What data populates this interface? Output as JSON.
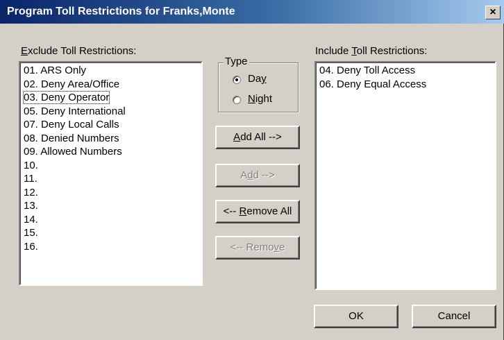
{
  "window": {
    "title": "Program Toll Restrictions for Franks,Monte",
    "close_label": "×"
  },
  "exclude": {
    "label_mnemonic": "E",
    "label_rest": "xclude Toll Restrictions:",
    "items": [
      "01. ARS Only",
      "02. Deny Area/Office",
      "03. Deny Operator",
      "05. Deny International",
      "07. Deny Local Calls",
      "08. Denied Numbers",
      "09. Allowed Numbers",
      "10.",
      "11.",
      "12.",
      "13.",
      "14.",
      "15.",
      "16."
    ],
    "focused_index": 2
  },
  "type": {
    "label": "Type",
    "day": {
      "pre": "Da",
      "mnemonic": "y",
      "post": "",
      "checked": true
    },
    "night": {
      "pre": "",
      "mnemonic": "N",
      "post": "ight",
      "checked": false
    }
  },
  "buttons": {
    "add_all": {
      "pre": "",
      "mnemonic": "A",
      "post": "dd All -->",
      "enabled": true
    },
    "add": {
      "pre": "A",
      "mnemonic": "d",
      "post": "d -->",
      "enabled": false
    },
    "remove_all": {
      "pre": "<-- ",
      "mnemonic": "R",
      "post": "emove All",
      "enabled": true
    },
    "remove": {
      "pre": "<-- Remo",
      "mnemonic": "v",
      "post": "e",
      "enabled": false
    }
  },
  "include": {
    "label_pre": "Include ",
    "label_mnemonic": "T",
    "label_rest": "oll Restrictions:",
    "items": [
      "04. Deny Toll Access",
      "06. Deny Equal Access"
    ]
  },
  "footer": {
    "ok_label": "OK",
    "cancel_label": "Cancel"
  }
}
